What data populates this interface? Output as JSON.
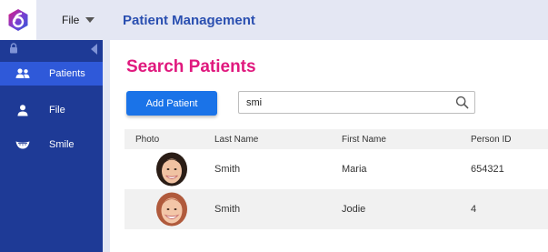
{
  "menu": {
    "file_label": "File"
  },
  "app": {
    "title": "Patient Management",
    "accent_color": "#e0197e",
    "brand_color": "#1e3a96"
  },
  "sidebar": {
    "items": [
      {
        "label": "Patients",
        "icon": "users-icon",
        "active": true
      },
      {
        "label": "File",
        "icon": "person-icon",
        "active": false
      },
      {
        "label": "Smile",
        "icon": "smile-icon",
        "active": false
      }
    ]
  },
  "main": {
    "page_title": "Search Patients",
    "add_button_label": "Add Patient",
    "search": {
      "value": "smi",
      "placeholder": ""
    }
  },
  "table": {
    "columns": [
      "Photo",
      "Last Name",
      "First Name",
      "Person ID"
    ],
    "rows": [
      {
        "photo": "avatar-photo",
        "last_name": "Smith",
        "first_name": "Maria",
        "person_id": "654321"
      },
      {
        "photo": "avatar-photo",
        "last_name": "Smith",
        "first_name": "Jodie",
        "person_id": "4"
      }
    ]
  }
}
